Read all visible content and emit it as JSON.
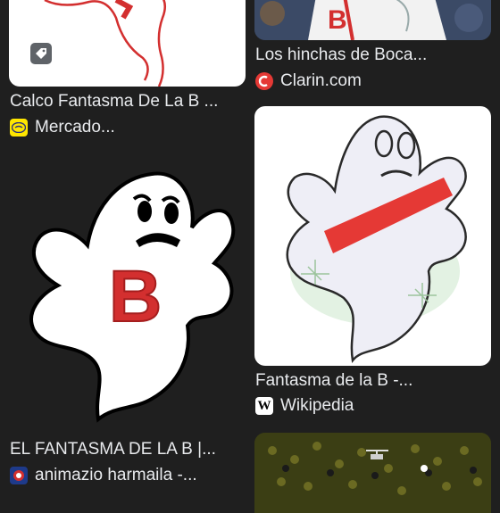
{
  "results": [
    {
      "title": "Calco Fantasma De La B ...",
      "source": "Mercado...",
      "favicon": "mercadolibre-handshake-icon"
    },
    {
      "title": "Los hinchas de Boca...",
      "source": "Clarin.com",
      "favicon": "clarin-icon"
    },
    {
      "title": "Fantasma de la B -...",
      "source": "Wikipedia",
      "favicon": "wikipedia-w-icon"
    },
    {
      "title": "EL FANTASMA DE LA B |...",
      "source": "animazio harmaila -...",
      "favicon": "animazio-icon"
    }
  ],
  "images": {
    "ghost_letter": "B",
    "fans_letter": "B"
  },
  "colors": {
    "background": "#1f1f1f",
    "text": "#e8eaed",
    "red": "#d32f2f"
  }
}
